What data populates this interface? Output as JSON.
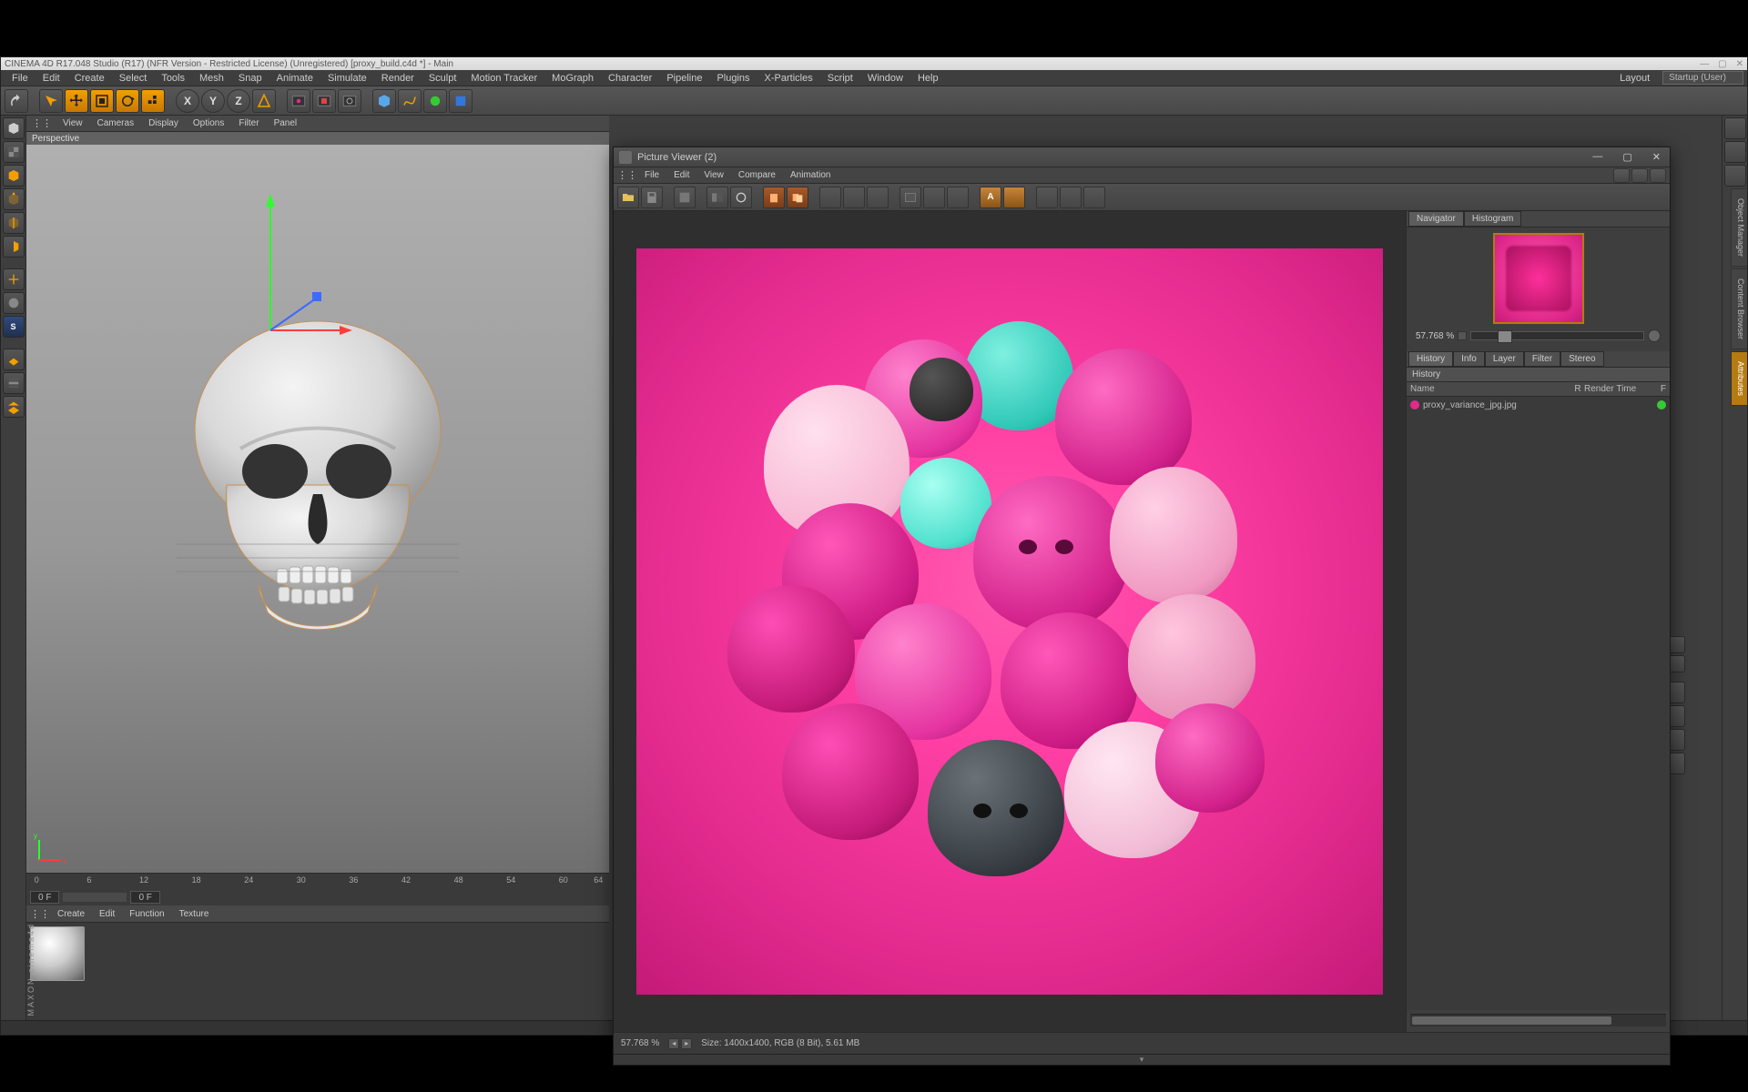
{
  "os_title": "CINEMA 4D R17.048 Studio (R17)  (NFR Version - Restricted License)  (Unregistered)  [proxy_build.c4d *] - Main",
  "menu": [
    "File",
    "Edit",
    "Create",
    "Select",
    "Tools",
    "Mesh",
    "Snap",
    "Animate",
    "Simulate",
    "Render",
    "Sculpt",
    "Motion Tracker",
    "MoGraph",
    "Character",
    "Pipeline",
    "Plugins",
    "X-Particles",
    "Script",
    "Window",
    "Help"
  ],
  "menu_right": {
    "layout_btn": "Layout",
    "layout_value": "Startup (User)"
  },
  "toolbar_axis": [
    "X",
    "Y",
    "Z"
  ],
  "viewport_menu": [
    "View",
    "Cameras",
    "Display",
    "Options",
    "Filter",
    "Panel"
  ],
  "viewport_name": "Perspective",
  "timeline_ticks": [
    "0",
    "6",
    "12",
    "18",
    "24",
    "30",
    "36",
    "42",
    "48",
    "54",
    "60",
    "64"
  ],
  "frame_field": "0 F",
  "frame_range": "0 F",
  "materials_menu": [
    "Create",
    "Edit",
    "Function",
    "Texture"
  ],
  "maxon": "MAXON cinema4d",
  "sidetabs": [
    "Object Manager",
    "Content Browser",
    "Attributes"
  ],
  "picture_viewer": {
    "title": "Picture Viewer (2)",
    "menu": [
      "File",
      "Edit",
      "View",
      "Compare",
      "Animation"
    ],
    "nav_tabs": [
      "Navigator",
      "Histogram"
    ],
    "zoom": "57.768 %",
    "tabs": [
      "History",
      "Info",
      "Layer",
      "Filter",
      "Stereo"
    ],
    "section": "History",
    "headers": {
      "name": "Name",
      "r": "R",
      "rendertime": "Render Time",
      "f": "F"
    },
    "rows": [
      {
        "name": "proxy_variance_jpg.jpg"
      }
    ],
    "status_zoom": "57.768 %",
    "status_info": "Size: 1400x1400, RGB (8 Bit), 5.61 MB"
  }
}
